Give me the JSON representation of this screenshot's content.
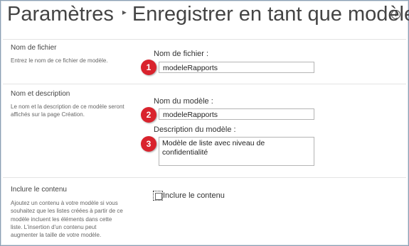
{
  "header": {
    "breadcrumb_root": "Paramètres",
    "separator": "▸",
    "page_title": "Enregistrer en tant que modèle",
    "info_icon": "i"
  },
  "sections": {
    "filename": {
      "title": "Nom de fichier",
      "description": "Entrez le nom de ce fichier de modèle.",
      "field_label": "Nom de fichier :",
      "value": "modeleRapports",
      "callout": "1"
    },
    "name_description": {
      "title": "Nom et description",
      "description": "Le nom et la description de ce modèle seront affichés sur la page Création.",
      "name_label": "Nom du modèle :",
      "name_value": "modeleRapports",
      "name_callout": "2",
      "desc_label": "Description du modèle :",
      "desc_value": "Modèle de liste avec niveau de confidentialité",
      "desc_callout": "3"
    },
    "include_content": {
      "title": "Inclure le contenu",
      "description": "Ajoutez un contenu à votre modèle si vous souhaitez que les listes créées à partir de ce modèle incluent les éléments dans cette liste. L'insertion d'un contenu peut augmenter la taille de votre modèle.",
      "checkbox_label": "Inclure le contenu",
      "checked": false
    }
  },
  "colors": {
    "callout": "#d9232d",
    "frame_border": "#8a9fb3"
  }
}
